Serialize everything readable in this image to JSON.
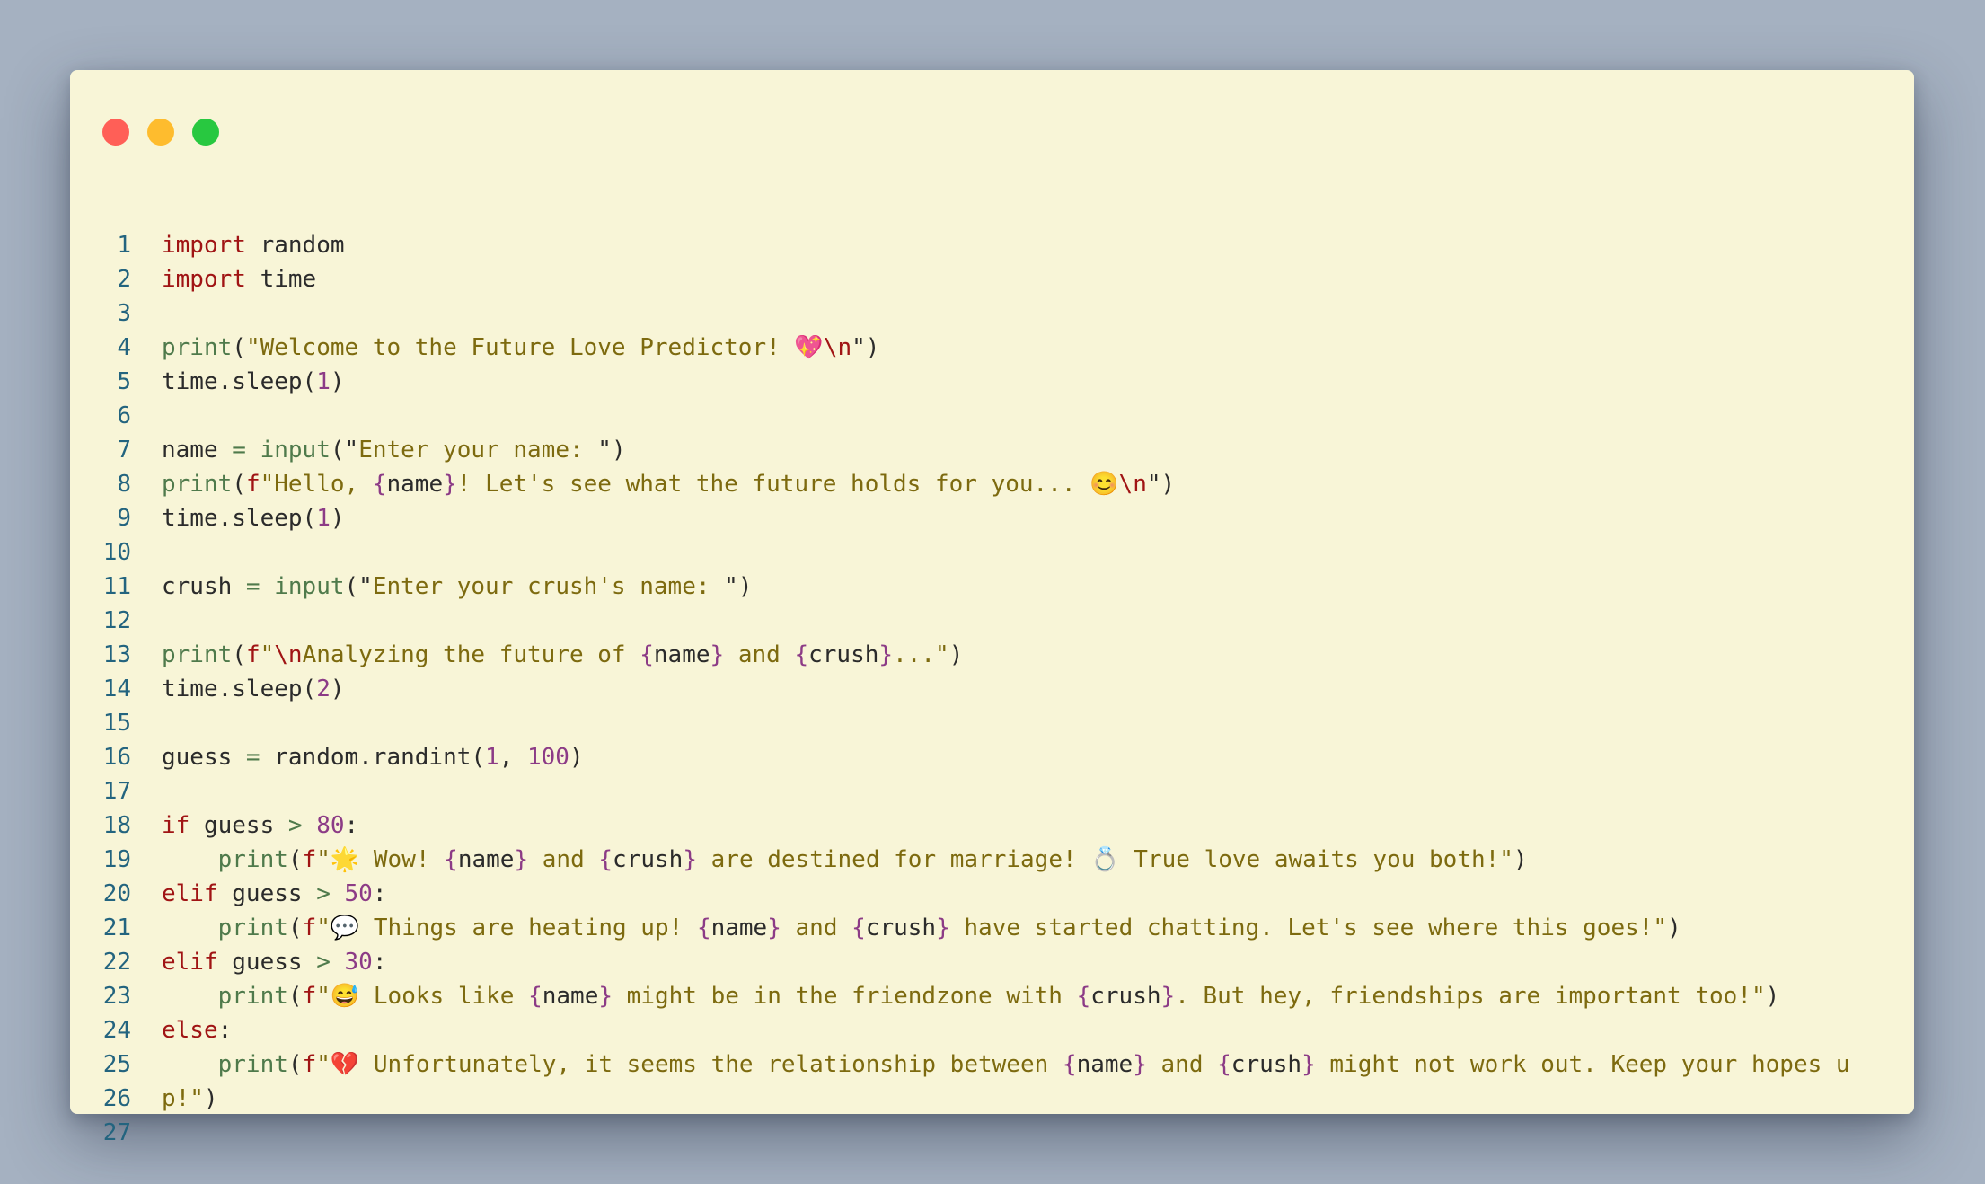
{
  "window": {
    "controls": [
      "close",
      "minimize",
      "maximize"
    ]
  },
  "code": {
    "lines": [
      {
        "n": "1",
        "tokens": [
          [
            "kw",
            "import"
          ],
          [
            "var",
            " random"
          ]
        ]
      },
      {
        "n": "2",
        "tokens": [
          [
            "kw",
            "import"
          ],
          [
            "var",
            " time"
          ]
        ]
      },
      {
        "n": "3",
        "tokens": []
      },
      {
        "n": "4",
        "tokens": [
          [
            "fn",
            "print"
          ],
          [
            "punc",
            "("
          ],
          [
            "str",
            "\"Welcome to the Future Love Predictor! "
          ],
          [
            "str",
            "💖"
          ],
          [
            "esc",
            "\\n"
          ],
          [
            "punc",
            "\")"
          ]
        ]
      },
      {
        "n": "5",
        "tokens": [
          [
            "var",
            "time.sleep("
          ],
          [
            "num",
            "1"
          ],
          [
            "var",
            ")"
          ]
        ]
      },
      {
        "n": "6",
        "tokens": []
      },
      {
        "n": "7",
        "tokens": [
          [
            "var",
            "name "
          ],
          [
            "op",
            "="
          ],
          [
            "var",
            " "
          ],
          [
            "fn",
            "input"
          ],
          [
            "punc",
            "(\""
          ],
          [
            "str",
            "Enter your name: "
          ],
          [
            "punc",
            "\")"
          ]
        ]
      },
      {
        "n": "8",
        "tokens": [
          [
            "fn",
            "print"
          ],
          [
            "punc",
            "("
          ],
          [
            "fpre",
            "f"
          ],
          [
            "str",
            "\"Hello, "
          ],
          [
            "brace",
            "{"
          ],
          [
            "var",
            "name"
          ],
          [
            "brace",
            "}"
          ],
          [
            "str",
            "! Let's see what the future holds for you... "
          ],
          [
            "str",
            "😊"
          ],
          [
            "esc",
            "\\n"
          ],
          [
            "punc",
            "\")"
          ]
        ]
      },
      {
        "n": "9",
        "tokens": [
          [
            "var",
            "time.sleep("
          ],
          [
            "num",
            "1"
          ],
          [
            "var",
            ")"
          ]
        ]
      },
      {
        "n": "10",
        "tokens": []
      },
      {
        "n": "11",
        "tokens": [
          [
            "var",
            "crush "
          ],
          [
            "op",
            "="
          ],
          [
            "var",
            " "
          ],
          [
            "fn",
            "input"
          ],
          [
            "punc",
            "(\""
          ],
          [
            "str",
            "Enter your crush's name: "
          ],
          [
            "punc",
            "\")"
          ]
        ]
      },
      {
        "n": "12",
        "tokens": []
      },
      {
        "n": "13",
        "tokens": [
          [
            "fn",
            "print"
          ],
          [
            "punc",
            "("
          ],
          [
            "fpre",
            "f"
          ],
          [
            "str",
            "\""
          ],
          [
            "esc",
            "\\n"
          ],
          [
            "str",
            "Analyzing the future of "
          ],
          [
            "brace",
            "{"
          ],
          [
            "var",
            "name"
          ],
          [
            "brace",
            "}"
          ],
          [
            "str",
            " and "
          ],
          [
            "brace",
            "{"
          ],
          [
            "var",
            "crush"
          ],
          [
            "brace",
            "}"
          ],
          [
            "str",
            "...\""
          ],
          [
            "punc",
            ")"
          ]
        ]
      },
      {
        "n": "14",
        "tokens": [
          [
            "var",
            "time.sleep("
          ],
          [
            "num",
            "2"
          ],
          [
            "var",
            ")"
          ]
        ]
      },
      {
        "n": "15",
        "tokens": []
      },
      {
        "n": "16",
        "tokens": [
          [
            "var",
            "guess "
          ],
          [
            "op",
            "="
          ],
          [
            "var",
            " random.randint("
          ],
          [
            "num",
            "1"
          ],
          [
            "var",
            ", "
          ],
          [
            "num",
            "100"
          ],
          [
            "var",
            ")"
          ]
        ]
      },
      {
        "n": "17",
        "tokens": []
      },
      {
        "n": "18",
        "tokens": [
          [
            "kw",
            "if"
          ],
          [
            "var",
            " guess "
          ],
          [
            "op",
            ">"
          ],
          [
            "var",
            " "
          ],
          [
            "num",
            "80"
          ],
          [
            "var",
            ":"
          ]
        ]
      },
      {
        "n": "19",
        "tokens": [
          [
            "var",
            "    "
          ],
          [
            "fn",
            "print"
          ],
          [
            "punc",
            "("
          ],
          [
            "fpre",
            "f"
          ],
          [
            "str",
            "\"🌟 Wow! "
          ],
          [
            "brace",
            "{"
          ],
          [
            "var",
            "name"
          ],
          [
            "brace",
            "}"
          ],
          [
            "str",
            " and "
          ],
          [
            "brace",
            "{"
          ],
          [
            "var",
            "crush"
          ],
          [
            "brace",
            "}"
          ],
          [
            "str",
            " are destined for marriage! 💍 True love awaits you both!\""
          ],
          [
            "punc",
            ")"
          ]
        ]
      },
      {
        "n": "20",
        "tokens": [
          [
            "kw",
            "elif"
          ],
          [
            "var",
            " guess "
          ],
          [
            "op",
            ">"
          ],
          [
            "var",
            " "
          ],
          [
            "num",
            "50"
          ],
          [
            "var",
            ":"
          ]
        ]
      },
      {
        "n": "21",
        "tokens": [
          [
            "var",
            "    "
          ],
          [
            "fn",
            "print"
          ],
          [
            "punc",
            "("
          ],
          [
            "fpre",
            "f"
          ],
          [
            "str",
            "\"💬 Things are heating up! "
          ],
          [
            "brace",
            "{"
          ],
          [
            "var",
            "name"
          ],
          [
            "brace",
            "}"
          ],
          [
            "str",
            " and "
          ],
          [
            "brace",
            "{"
          ],
          [
            "var",
            "crush"
          ],
          [
            "brace",
            "}"
          ],
          [
            "str",
            " have started chatting. Let's see where this goes!\""
          ],
          [
            "punc",
            ")"
          ]
        ]
      },
      {
        "n": "22",
        "tokens": [
          [
            "kw",
            "elif"
          ],
          [
            "var",
            " guess "
          ],
          [
            "op",
            ">"
          ],
          [
            "var",
            " "
          ],
          [
            "num",
            "30"
          ],
          [
            "var",
            ":"
          ]
        ]
      },
      {
        "n": "23",
        "tokens": [
          [
            "var",
            "    "
          ],
          [
            "fn",
            "print"
          ],
          [
            "punc",
            "("
          ],
          [
            "fpre",
            "f"
          ],
          [
            "str",
            "\"😅 Looks like "
          ],
          [
            "brace",
            "{"
          ],
          [
            "var",
            "name"
          ],
          [
            "brace",
            "}"
          ],
          [
            "str",
            " might be in the friendzone with "
          ],
          [
            "brace",
            "{"
          ],
          [
            "var",
            "crush"
          ],
          [
            "brace",
            "}"
          ],
          [
            "str",
            ". But hey, friendships are important too!\""
          ],
          [
            "punc",
            ")"
          ]
        ]
      },
      {
        "n": "24",
        "tokens": [
          [
            "kw",
            "else"
          ],
          [
            "var",
            ":"
          ]
        ]
      },
      {
        "n": "25",
        "tokens": [
          [
            "var",
            "    "
          ],
          [
            "fn",
            "print"
          ],
          [
            "punc",
            "("
          ],
          [
            "fpre",
            "f"
          ],
          [
            "str",
            "\"💔 Unfortunately, it seems the relationship between "
          ],
          [
            "brace",
            "{"
          ],
          [
            "var",
            "name"
          ],
          [
            "brace",
            "}"
          ],
          [
            "str",
            " and "
          ],
          [
            "brace",
            "{"
          ],
          [
            "var",
            "crush"
          ],
          [
            "brace",
            "}"
          ],
          [
            "str",
            " might not work out. Keep your hopes u"
          ]
        ]
      },
      {
        "n": "26",
        "tokens": [
          [
            "str",
            "p!\""
          ],
          [
            "punc",
            ")"
          ]
        ]
      },
      {
        "n": "27",
        "tokens": []
      }
    ]
  }
}
